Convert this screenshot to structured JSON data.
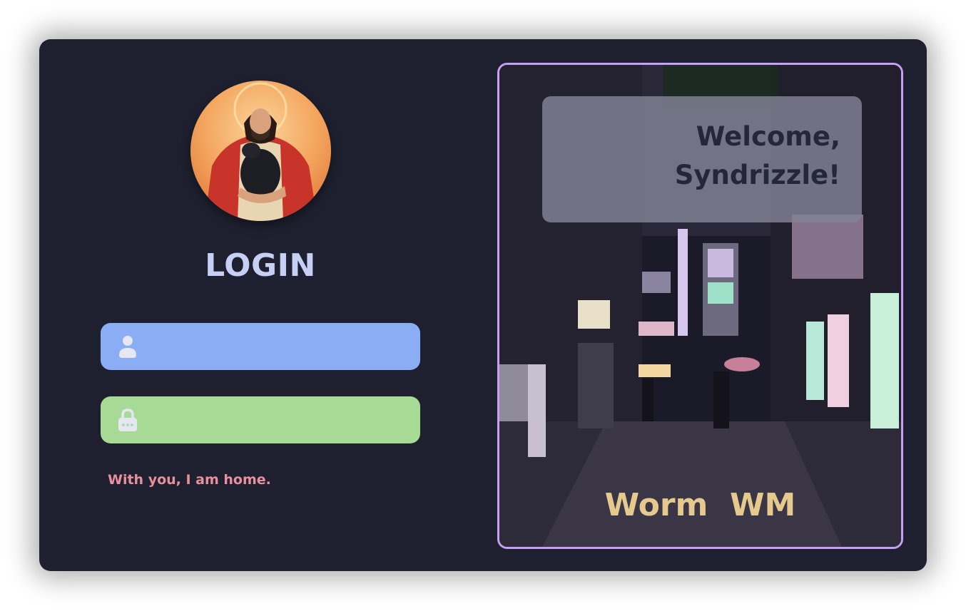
{
  "login": {
    "title": "LOGIN",
    "username": {
      "value": "",
      "placeholder": "",
      "icon": "user-icon"
    },
    "password": {
      "value": "",
      "placeholder": "",
      "icon": "lock-icon"
    },
    "quote": "With you, I am home."
  },
  "panel": {
    "welcome_line1": "Welcome,",
    "welcome_line2": "Syndrizzle!",
    "brand": "Worm  WM"
  },
  "colors": {
    "background": "#1e2030",
    "title": "#c6d0f5",
    "username_field": "#8aadf4",
    "password_field": "#a6da95",
    "quote": "#e8909b",
    "panel_border": "#c6a0f6",
    "brand": "#e6c98c"
  }
}
